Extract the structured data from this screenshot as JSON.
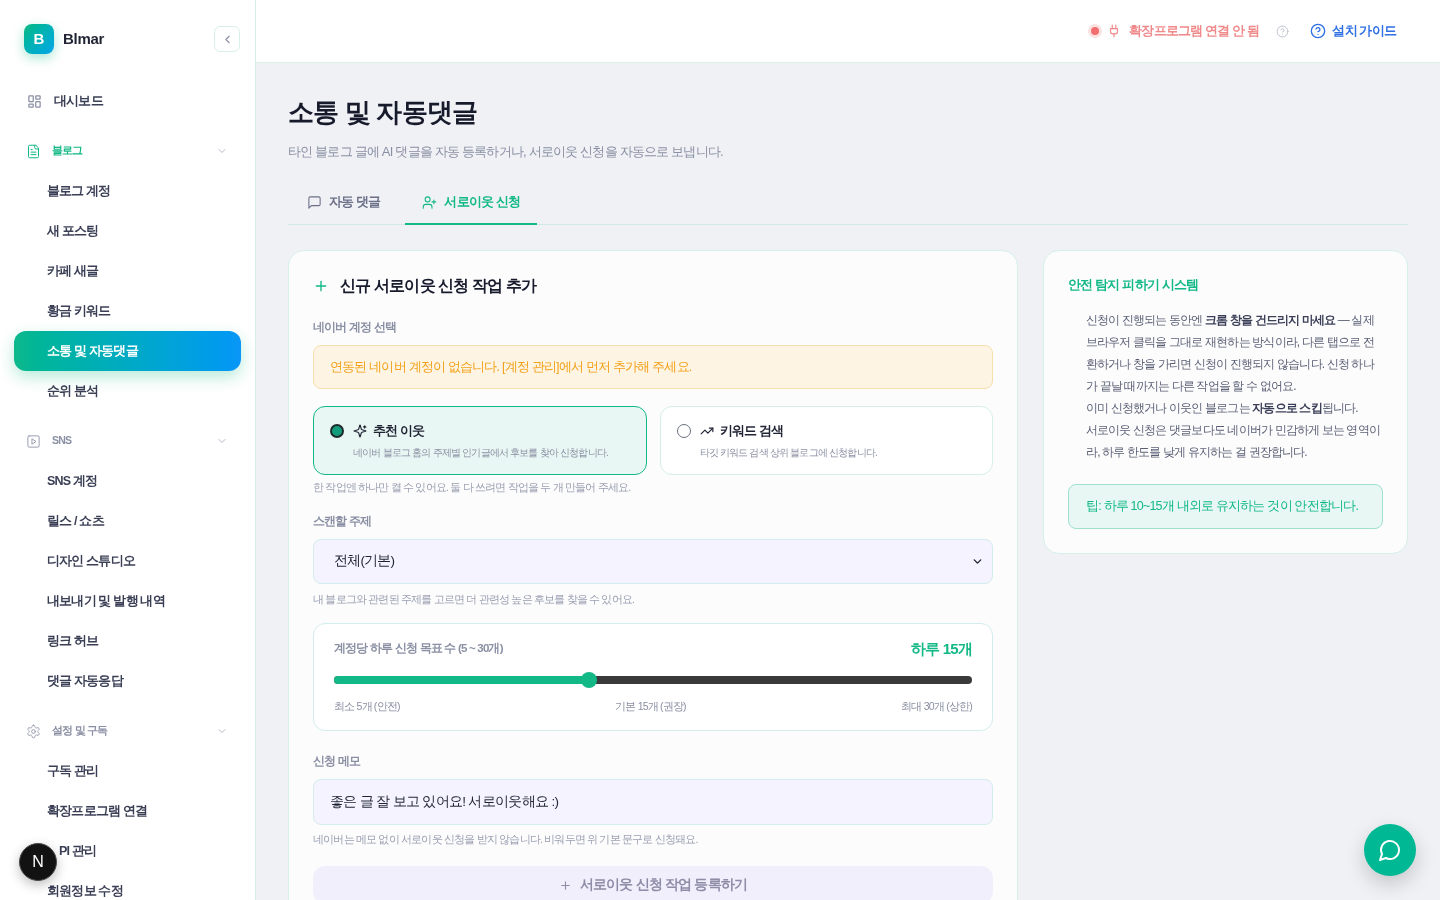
{
  "sidebar": {
    "logo": {
      "mark": "B",
      "name": "Blmar"
    },
    "top_items": [
      {
        "label": "대시보드",
        "selected": false
      }
    ],
    "sections": [
      {
        "kind": "blog",
        "label": "블로그",
        "active": true,
        "expanded": true,
        "items": [
          {
            "label": "블로그 계정",
            "selected": false
          },
          {
            "label": "새 포스팅",
            "selected": false
          },
          {
            "label": "카페 새글",
            "selected": false
          },
          {
            "label": "황금 키워드",
            "selected": false
          },
          {
            "label": "소통 및 자동댓글",
            "selected": true
          },
          {
            "label": "순위 분석",
            "selected": false
          }
        ]
      },
      {
        "kind": "sns",
        "label": "SNS",
        "active": false,
        "expanded": true,
        "items": [
          {
            "label": "SNS 계정",
            "selected": false
          },
          {
            "label": "릴스 / 쇼츠",
            "selected": false
          },
          {
            "label": "디자인 스튜디오",
            "selected": false
          },
          {
            "label": "내보내기 및 발행 내역",
            "selected": false
          },
          {
            "label": "링크 허브",
            "selected": false
          },
          {
            "label": "댓글 자동응답",
            "selected": false
          }
        ]
      },
      {
        "kind": "settings",
        "label": "설정 및 구독",
        "active": false,
        "expanded": true,
        "items": [
          {
            "label": "구독 관리",
            "selected": false
          },
          {
            "label": "확장프로그램 연결",
            "selected": false
          },
          {
            "label": "PI 관리",
            "selected": false
          },
          {
            "label": "회원정보 수정",
            "selected": false
          }
        ]
      }
    ]
  },
  "header": {
    "extension_status": {
      "label": "확장프로그램 연결 안 됨",
      "connected": false
    },
    "guide_link": "설치 가이드"
  },
  "page": {
    "title": "소통 및 자동댓글",
    "subtitle": "타인 블로그 글에 AI 댓글을 자동 등록하거나, 서로이웃 신청을 자동으로 보냅니다.",
    "tabs": [
      {
        "kind": "comment",
        "label": "자동 댓글",
        "selected": false
      },
      {
        "kind": "neighbor",
        "label": "서로이웃 신청",
        "selected": true
      }
    ]
  },
  "task_form": {
    "heading": "신규 서로이웃 신청 작업 추가",
    "account": {
      "label": "네이버 계정 선택",
      "warning": "연동된 네이버 계정이 없습니다. [계정 관리]에서 먼저 추가해 주세요."
    },
    "modes": [
      {
        "kind": "recommended",
        "title": "추천 이웃",
        "description": "네이버 블로그 홈의 주제별 인기글에서 후보를 찾아 신청합니다.",
        "selected": true
      },
      {
        "kind": "keyword",
        "title": "키워드 검색",
        "description": "타깃 키워드 검색 상위 블로그에 신청합니다.",
        "selected": false
      }
    ],
    "modes_hint": "한 작업엔 하나만 켤 수 있어요. 둘 다 쓰려면 작업을 두 개 만들어 주세요.",
    "topic": {
      "label": "스캔할 주제",
      "value": "전체(기본)",
      "hint": "내 블로그와 관련된 주제를 고르면 더 관련성 높은 후보를 찾을 수 있어요."
    },
    "daily_target": {
      "label": "계정당 하루 신청 목표 수 (5 ~ 30개)",
      "value_text": "하루 15개",
      "level": 0.4,
      "ticks": [
        "최소 5개 (안전)",
        "기본 15개 (권장)",
        "최대 30개 (상한)"
      ]
    },
    "memo": {
      "label": "신청 메모",
      "value": "좋은 글 잘 보고 있어요! 서로이웃해요 :)",
      "hint": "네이버는 메모 없이 서로이웃 신청을 받지 않습니다. 비워두면 위 기본 문구로 신청돼요."
    },
    "submit": {
      "label": "서로이웃 신청 작업 등록하기",
      "disabled": true
    }
  },
  "safety_card": {
    "title": "안전 탐지 피하기 시스템",
    "paragraphs": [
      "신청이 진행되는 동안엔 **크롬 창을 건드리지 마세요** — 실제 브라우저 클릭을 그대로 재현하는 방식이라, 다른 탭으로 전환하거나 창을 가리면 신청이 진행되지 않습니다. 신청 하나가 끝날 때까지는 다른 작업을 할 수 없어요.",
      "이미 신청했거나 이웃인 블로그는 **자동으로 스킵**됩니다.",
      "서로이웃 신청은 댓글보다도 네이버가 민감하게 보는 영역이라, 하루 한도를 낮게 유지하는 걸 권장합니다."
    ],
    "tip": "팁: 하루 10~15개 내외로 유지하는 것이 안전합니다."
  },
  "dev_indicator": {
    "label": "N"
  }
}
